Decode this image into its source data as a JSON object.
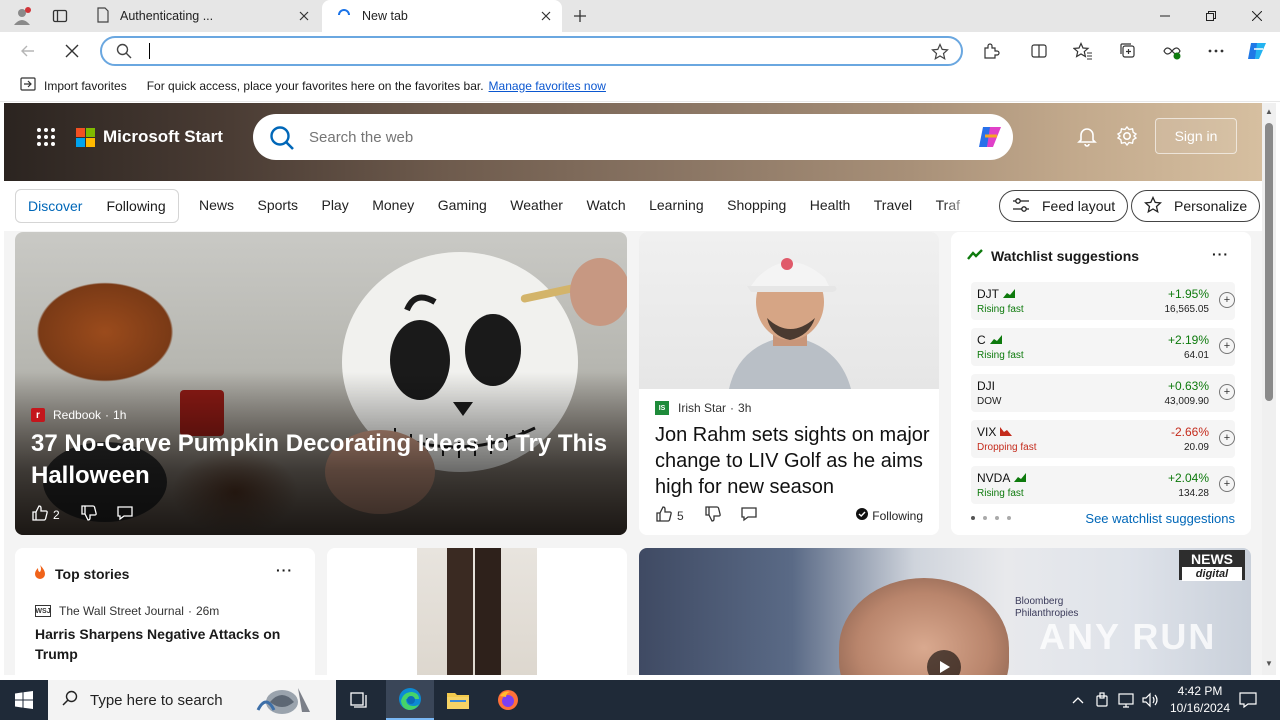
{
  "browser": {
    "tabs": [
      {
        "label": "Authenticating ...",
        "active": false
      },
      {
        "label": "New tab",
        "active": true
      }
    ],
    "address": {
      "value": "",
      "placeholder": ""
    },
    "favorites_bar": {
      "import_label": "Import favorites",
      "message": "For quick access, place your favorites here on the favorites bar.",
      "manage_link": "Manage favorites now"
    }
  },
  "msn": {
    "brand": "Microsoft Start",
    "search_placeholder": "Search the web",
    "sign_in": "Sign in",
    "segment": [
      "Discover",
      "Following"
    ],
    "categories": [
      "News",
      "Sports",
      "Play",
      "Money",
      "Gaming",
      "Weather",
      "Watch",
      "Learning",
      "Shopping",
      "Health",
      "Travel",
      "Traf"
    ],
    "feed_layout": "Feed layout",
    "personalize": "Personalize"
  },
  "hero_card": {
    "source": "Redbook",
    "age": "1h",
    "title": "37 No-Carve Pumpkin Decorating Ideas to Try This Halloween",
    "likes": "2"
  },
  "rahm_card": {
    "source": "Irish Star",
    "age": "3h",
    "title": "Jon Rahm sets sights on major change to LIV Golf as he aims high for new season",
    "likes": "5",
    "following": "Following"
  },
  "watchlist": {
    "title": "Watchlist suggestions",
    "rows": [
      {
        "symbol": "DJT",
        "status": "Rising fast",
        "change": "+1.95%",
        "value": "16,565.05",
        "dir": "up"
      },
      {
        "symbol": "C",
        "status": "Rising fast",
        "change": "+2.19%",
        "value": "64.01",
        "dir": "up"
      },
      {
        "symbol": "DJI",
        "status": "DOW",
        "change": "+0.63%",
        "value": "43,009.90",
        "dir": "up"
      },
      {
        "symbol": "VIX",
        "status": "Dropping fast",
        "change": "-2.66%",
        "value": "20.09",
        "dir": "down"
      },
      {
        "symbol": "NVDA",
        "status": "Rising fast",
        "change": "+2.04%",
        "value": "134.28",
        "dir": "up"
      }
    ],
    "see_more": "See watchlist suggestions"
  },
  "top_stories": {
    "title": "Top stories",
    "source": "The Wall Street Journal",
    "age": "26m",
    "headline": "Harris Sharpens Negative Attacks on Trump"
  },
  "video_card": {
    "channel_top": "NEWS",
    "channel_bottom": "digital",
    "brand_line1": "Bloomberg",
    "brand_line2": "Philanthropies",
    "watermark": "ANY RUN"
  },
  "taskbar": {
    "search_placeholder": "Type here to search",
    "time": "4:42 PM",
    "date": "10/16/2024"
  },
  "colors": {
    "accent": "#0067b8",
    "up": "#0e7a0d",
    "down": "#c42b1c"
  }
}
